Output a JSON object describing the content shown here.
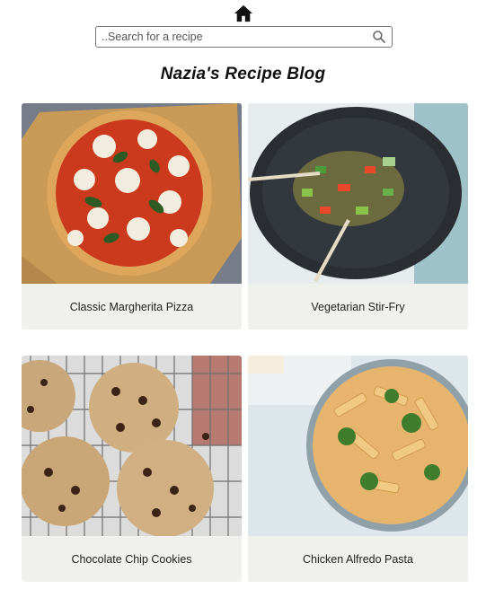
{
  "nav": {
    "home_icon": "home-icon"
  },
  "search": {
    "placeholder": "..Search for a recipe",
    "value": "",
    "icon": "search-icon"
  },
  "blog_title": "Nazia's Recipe Blog",
  "recipes": [
    {
      "name": "Classic Margherita Pizza"
    },
    {
      "name": "Vegetarian Stir-Fry"
    },
    {
      "name": "Chocolate Chip Cookies"
    },
    {
      "name": "Chicken Alfredo Pasta"
    }
  ]
}
